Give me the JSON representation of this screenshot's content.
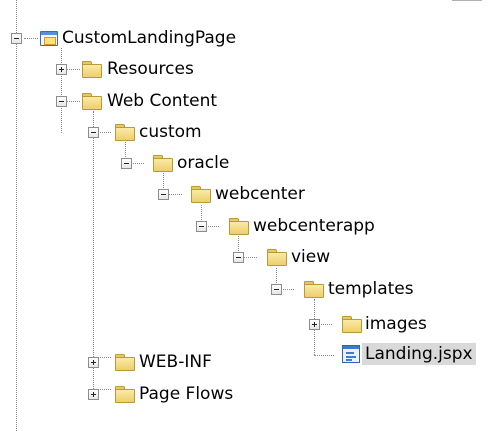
{
  "tree": {
    "root": "CustomLandingPage",
    "resources": "Resources",
    "web_content": "Web Content",
    "custom": "custom",
    "oracle": "oracle",
    "webcenter": "webcenter",
    "webcenterapp": "webcenterapp",
    "view": "view",
    "templates": "templates",
    "images": "images",
    "landing": "Landing.jspx",
    "web_inf": "WEB-INF",
    "page_flows": "Page Flows"
  },
  "icons": {
    "project": "project-icon",
    "folder": "folder-icon",
    "jspx": "jspx-file-icon",
    "expand": "expand-toggle-icon",
    "collapse": "collapse-toggle-icon"
  },
  "colors": {
    "folder_fill": "#eccf6e",
    "selection": "#d9d9d9"
  }
}
